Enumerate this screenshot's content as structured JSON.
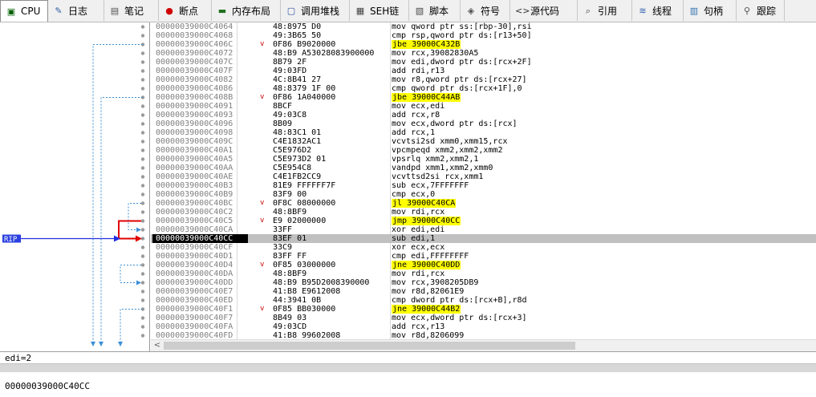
{
  "tabs": [
    {
      "label": "CPU",
      "icon": "cpu-icon",
      "glyph": "▣"
    },
    {
      "label": "日志",
      "icon": "log-icon",
      "glyph": "✎"
    },
    {
      "label": "笔记",
      "icon": "notes-icon",
      "glyph": "▤"
    },
    {
      "label": "断点",
      "icon": "breakpoint-icon",
      "glyph": "●"
    },
    {
      "label": "内存布局",
      "icon": "memory-map-icon",
      "glyph": "▬"
    },
    {
      "label": "调用堆栈",
      "icon": "call-stack-icon",
      "glyph": "▢"
    },
    {
      "label": "SEH链",
      "icon": "seh-chain-icon",
      "glyph": "▦"
    },
    {
      "label": "脚本",
      "icon": "script-icon",
      "glyph": "▧"
    },
    {
      "label": "符号",
      "icon": "symbols-icon",
      "glyph": "◈"
    },
    {
      "label": "源代码",
      "icon": "source-code-icon",
      "glyph": "<>"
    },
    {
      "label": "引用",
      "icon": "references-icon",
      "glyph": "⌕"
    },
    {
      "label": "线程",
      "icon": "threads-icon",
      "glyph": "≋"
    },
    {
      "label": "句柄",
      "icon": "handles-icon",
      "glyph": "▥"
    },
    {
      "label": "跟踪",
      "icon": "trace-icon",
      "glyph": "⚲"
    }
  ],
  "rip_label": "RIP",
  "rows": [
    {
      "addr": "00000039000C4064",
      "mark": "",
      "bytes": "48:8975 D0",
      "instr": "mov qword ptr ss:[rbp-30],rsi",
      "jmp": false
    },
    {
      "addr": "00000039000C4068",
      "mark": "",
      "bytes": "49:3B65 50",
      "instr": "cmp rsp,qword ptr ds:[r13+50]",
      "jmp": false
    },
    {
      "addr": "00000039000C406C",
      "mark": "v",
      "bytes": "0F86 B9020000",
      "instr": "jbe 39000C432B",
      "jmp": true
    },
    {
      "addr": "00000039000C4072",
      "mark": "",
      "bytes": "48:B9 A53028083900000",
      "instr": "mov rcx,39082830A5",
      "jmp": false
    },
    {
      "addr": "00000039000C407C",
      "mark": "",
      "bytes": "8B79 2F",
      "instr": "mov edi,dword ptr ds:[rcx+2F]",
      "jmp": false
    },
    {
      "addr": "00000039000C407F",
      "mark": "",
      "bytes": "49:03FD",
      "instr": "add rdi,r13",
      "jmp": false
    },
    {
      "addr": "00000039000C4082",
      "mark": "",
      "bytes": "4C:8B41 27",
      "instr": "mov r8,qword ptr ds:[rcx+27]",
      "jmp": false
    },
    {
      "addr": "00000039000C4086",
      "mark": "",
      "bytes": "48:8379 1F 00",
      "instr": "cmp qword ptr ds:[rcx+1F],0",
      "jmp": false
    },
    {
      "addr": "00000039000C408B",
      "mark": "v",
      "bytes": "0F86 1A040000",
      "instr": "jbe 39000C44AB",
      "jmp": true
    },
    {
      "addr": "00000039000C4091",
      "mark": "",
      "bytes": "8BCF",
      "instr": "mov ecx,edi",
      "jmp": false
    },
    {
      "addr": "00000039000C4093",
      "mark": "",
      "bytes": "49:03C8",
      "instr": "add rcx,r8",
      "jmp": false
    },
    {
      "addr": "00000039000C4096",
      "mark": "",
      "bytes": "8B09",
      "instr": "mov ecx,dword ptr ds:[rcx]",
      "jmp": false
    },
    {
      "addr": "00000039000C4098",
      "mark": "",
      "bytes": "48:83C1 01",
      "instr": "add rcx,1",
      "jmp": false
    },
    {
      "addr": "00000039000C409C",
      "mark": "",
      "bytes": "C4E1832AC1",
      "instr": "vcvtsi2sd xmm0,xmm15,rcx",
      "jmp": false
    },
    {
      "addr": "00000039000C40A1",
      "mark": "",
      "bytes": "C5E976D2",
      "instr": "vpcmpeqd xmm2,xmm2,xmm2",
      "jmp": false
    },
    {
      "addr": "00000039000C40A5",
      "mark": "",
      "bytes": "C5E973D2 01",
      "instr": "vpsrlq xmm2,xmm2,1",
      "jmp": false
    },
    {
      "addr": "00000039000C40AA",
      "mark": "",
      "bytes": "C5E954C8",
      "instr": "vandpd xmm1,xmm2,xmm0",
      "jmp": false
    },
    {
      "addr": "00000039000C40AE",
      "mark": "",
      "bytes": "C4E1FB2CC9",
      "instr": "vcvttsd2si rcx,xmm1",
      "jmp": false
    },
    {
      "addr": "00000039000C40B3",
      "mark": "",
      "bytes": "81E9 FFFFFF7F",
      "instr": "sub ecx,7FFFFFFF",
      "jmp": false
    },
    {
      "addr": "00000039000C40B9",
      "mark": "",
      "bytes": "83F9 00",
      "instr": "cmp ecx,0",
      "jmp": false
    },
    {
      "addr": "00000039000C40BC",
      "mark": "v",
      "bytes": "0F8C 08000000",
      "instr": "jl 39000C40CA",
      "jmp": true
    },
    {
      "addr": "00000039000C40C2",
      "mark": "",
      "bytes": "48:8BF9",
      "instr": "mov rdi,rcx",
      "jmp": false
    },
    {
      "addr": "00000039000C40C5",
      "mark": "v",
      "bytes": "E9 02000000",
      "instr": "jmp 39000C40CC",
      "jmp": true
    },
    {
      "addr": "00000039000C40CA",
      "mark": "",
      "bytes": "33FF",
      "instr": "xor edi,edi",
      "jmp": false
    },
    {
      "addr": "00000039000C40CC",
      "mark": "",
      "bytes": "83EF 01",
      "instr": "sub edi,1",
      "jmp": false
    },
    {
      "addr": "00000039000C40CF",
      "mark": "",
      "bytes": "33C9",
      "instr": "xor ecx,ecx",
      "jmp": false
    },
    {
      "addr": "00000039000C40D1",
      "mark": "",
      "bytes": "83FF FF",
      "instr": "cmp edi,FFFFFFFF",
      "jmp": false
    },
    {
      "addr": "00000039000C40D4",
      "mark": "v",
      "bytes": "0F85 03000000",
      "instr": "jne 39000C40DD",
      "jmp": true
    },
    {
      "addr": "00000039000C40DA",
      "mark": "",
      "bytes": "48:8BF9",
      "instr": "mov rdi,rcx",
      "jmp": false
    },
    {
      "addr": "00000039000C40DD",
      "mark": "",
      "bytes": "48:B9 B95D2008390000",
      "instr": "mov rcx,3908205DB9",
      "jmp": false
    },
    {
      "addr": "00000039000C40E7",
      "mark": "",
      "bytes": "41:B8 E9612008",
      "instr": "mov r8d,82061E9",
      "jmp": false
    },
    {
      "addr": "00000039000C40ED",
      "mark": "",
      "bytes": "44:3941 0B",
      "instr": "cmp dword ptr ds:[rcx+B],r8d",
      "jmp": false
    },
    {
      "addr": "00000039000C40F1",
      "mark": "v",
      "bytes": "0F85 BB030000",
      "instr": "jne 39000C44B2",
      "jmp": true
    },
    {
      "addr": "00000039000C40F7",
      "mark": "",
      "bytes": "8B49 03",
      "instr": "mov ecx,dword ptr ds:[rcx+3]",
      "jmp": false
    },
    {
      "addr": "00000039000C40FA",
      "mark": "",
      "bytes": "49:03CD",
      "instr": "add rcx,r13",
      "jmp": false
    },
    {
      "addr": "00000039000C40FD",
      "mark": "",
      "bytes": "41:B8 99602008",
      "instr": "mov r8d,8206099",
      "jmp": false
    }
  ],
  "current_index": 24,
  "info_line1": "edi=2",
  "info_line2": "00000039000C40CC"
}
